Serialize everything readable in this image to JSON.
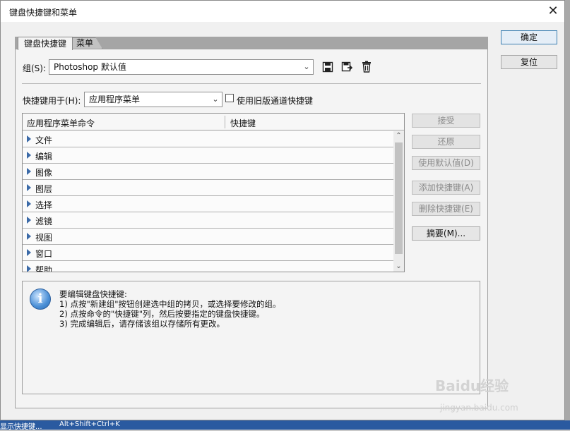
{
  "window": {
    "title": "键盘快捷键和菜单",
    "close_glyph": "✕"
  },
  "buttons": {
    "ok": "确定",
    "reset": "复位",
    "accept": "接受",
    "undo": "还原",
    "use_default": "使用默认值(D)",
    "add_shortcut": "添加快捷键(A)",
    "delete_shortcut": "删除快捷键(E)",
    "summary": "摘要(M)..."
  },
  "tabs": [
    {
      "label": "键盘快捷键",
      "active": true
    },
    {
      "label": "菜单",
      "active": false
    }
  ],
  "set_row": {
    "label": "组(S):",
    "value": "Photoshop 默认值",
    "icons": [
      "save-icon",
      "save-as-icon",
      "delete-icon"
    ]
  },
  "shortcuts_for": {
    "label": "快捷键用于(H):",
    "value": "应用程序菜单",
    "legacy_checkbox_label": "使用旧版通道快捷键",
    "legacy_checked": false
  },
  "table": {
    "columns": [
      "应用程序菜单命令",
      "快捷键"
    ],
    "rows": [
      "文件",
      "编辑",
      "图像",
      "图层",
      "选择",
      "滤镜",
      "视图",
      "窗口",
      "帮助"
    ]
  },
  "info": {
    "lines": [
      "要编辑键盘快捷键:",
      "1) 点按\"新建组\"按钮创建选中组的拷贝，或选择要修改的组。",
      "2) 点按命令的\"快捷键\"列，然后按要指定的键盘快捷键。",
      "3) 完成编辑后，请存储该组以存储所有更改。"
    ]
  },
  "taskbar": {
    "left": "显示快捷键...",
    "right": "Alt+Shift+Ctrl+K"
  },
  "watermark": {
    "text": "Baidu经验",
    "sub": "jingyan.baidu.com"
  },
  "colors": {
    "accent": "#3c7fb1",
    "tree_arrow": "#3b6aa8",
    "dialog_bg": "#f0f0f0"
  }
}
